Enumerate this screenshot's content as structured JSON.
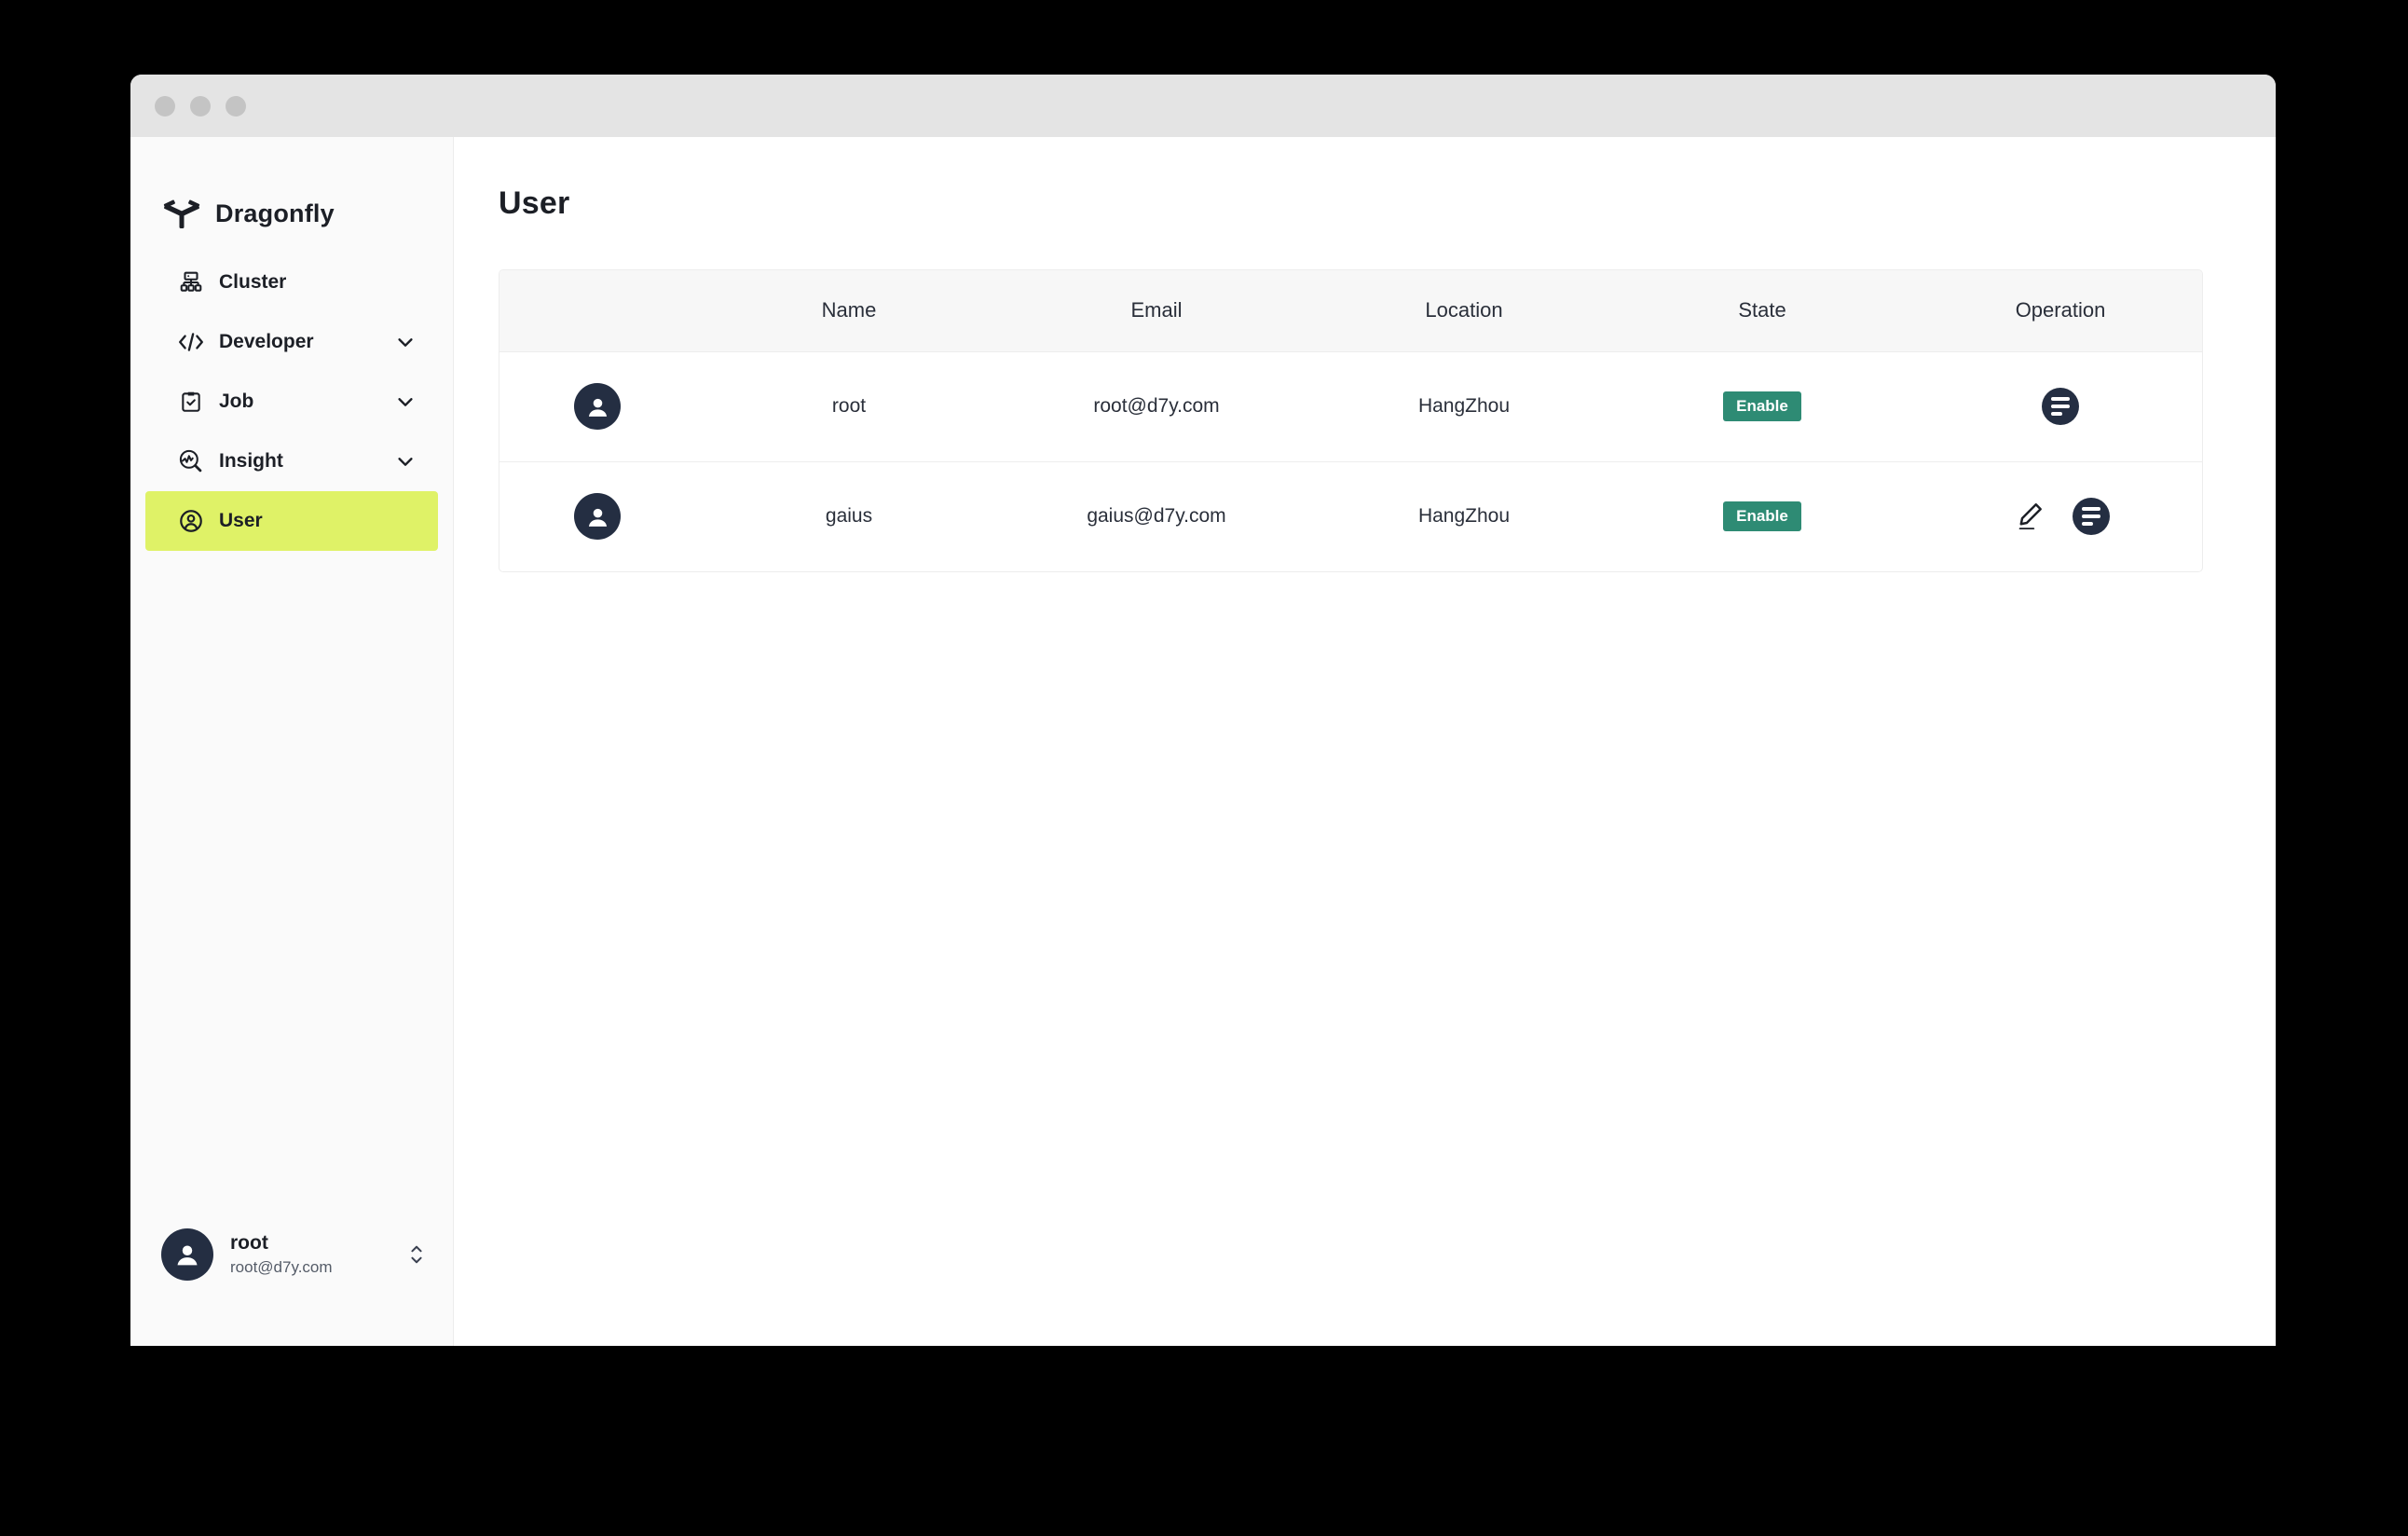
{
  "window": {
    "traffic_lights": [
      "close",
      "minimize",
      "maximize"
    ]
  },
  "sidebar": {
    "brand": {
      "name": "Dragonfly",
      "logo_icon": "dragonfly-logo-icon"
    },
    "items": [
      {
        "label": "Cluster",
        "icon": "cluster-icon",
        "expandable": false,
        "active": false
      },
      {
        "label": "Developer",
        "icon": "code-icon",
        "expandable": true,
        "active": false
      },
      {
        "label": "Job",
        "icon": "clipboard-check-icon",
        "expandable": true,
        "active": false
      },
      {
        "label": "Insight",
        "icon": "insight-search-icon",
        "expandable": true,
        "active": false
      },
      {
        "label": "User",
        "icon": "user-circle-icon",
        "expandable": false,
        "active": true
      }
    ],
    "profile": {
      "name": "root",
      "email": "root@d7y.com",
      "avatar_icon": "avatar-icon",
      "toggle_icon": "chevron-up-down-icon"
    }
  },
  "main": {
    "page_title": "User",
    "table": {
      "headers": [
        "",
        "Name",
        "Email",
        "Location",
        "State",
        "Operation"
      ],
      "rows": [
        {
          "avatar_icon": "avatar-icon",
          "name": "root",
          "email": "root@d7y.com",
          "location": "HangZhou",
          "state": "Enable",
          "operations": [
            "menu-icon"
          ]
        },
        {
          "avatar_icon": "avatar-icon",
          "name": "gaius",
          "email": "gaius@d7y.com",
          "location": "HangZhou",
          "state": "Enable",
          "operations": [
            "edit-pencil-icon",
            "menu-icon"
          ]
        }
      ]
    }
  },
  "colors": {
    "accent_highlight": "#dff267",
    "badge_enable": "#2e8b74",
    "dark": "#242e42",
    "sidebar_bg": "#fafafa",
    "header_bg": "#f7f7f7"
  }
}
